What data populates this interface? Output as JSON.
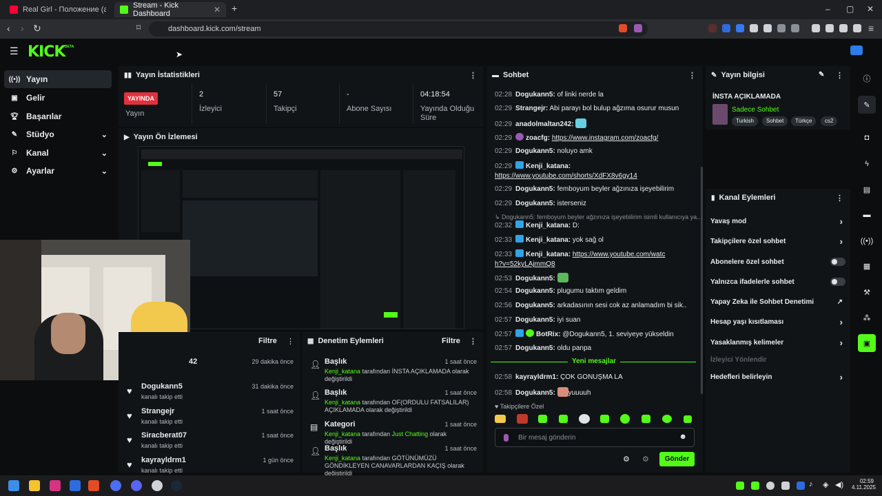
{
  "browser": {
    "tabs": [
      {
        "title": "Real Girl - Положение (alisherza"
      },
      {
        "title": "Stream - Kick Dashboard"
      }
    ],
    "url": "dashboard.kick.com/stream"
  },
  "brand": {
    "logo": "KICK",
    "beta": "BETA",
    "accent": "#53fc18"
  },
  "nav": {
    "items": [
      {
        "label": "Yayın",
        "icon": "broadcast-icon"
      },
      {
        "label": "Gelir",
        "icon": "revenue-icon"
      },
      {
        "label": "Başarılar",
        "icon": "trophy-icon"
      },
      {
        "label": "Stüdyo",
        "icon": "studio-icon"
      },
      {
        "label": "Kanal",
        "icon": "channel-icon"
      },
      {
        "label": "Ayarlar",
        "icon": "gear-icon"
      }
    ]
  },
  "stats": {
    "title": "Yayın İstatistikleri",
    "live_badge": "YAYINDA",
    "items": [
      {
        "label": "Yayın",
        "value": ""
      },
      {
        "label": "İzleyici",
        "value": "2"
      },
      {
        "label": "Takipçi",
        "value": "57"
      },
      {
        "label": "Abone Sayısı",
        "value": "-"
      },
      {
        "label": "Yayında Olduğu Süre",
        "value": "04:18:54"
      }
    ]
  },
  "preview": {
    "title": "Yayın Ön İzlemesi"
  },
  "followers": {
    "filter_label": "Filtre",
    "first_time": "29 dakika önce",
    "first_partial": "42",
    "items": [
      {
        "name": "Dogukann5",
        "sub": "kanalı takip etti",
        "time": "31 dakika önce"
      },
      {
        "name": "Strangejr",
        "sub": "kanalı takip etti",
        "time": "1 saat önce"
      },
      {
        "name": "Siracberat07",
        "sub": "kanalı takip etti",
        "time": "1 saat önce"
      },
      {
        "name": "kayrayldrm1",
        "sub": "kanalı takip etti",
        "time": "1 gün önce"
      }
    ]
  },
  "moderation": {
    "title": "Denetim Eylemleri",
    "filter_label": "Filtre",
    "items": [
      {
        "title": "Başlık",
        "user": "Kenji_katana",
        "pre": "tarafından ",
        "value": "İNSTA AÇIKLAMADA",
        "post": " olarak değiştirildi",
        "time": "1 saat önce"
      },
      {
        "title": "Başlık",
        "user": "Kenji_katana",
        "pre": "tarafından ",
        "value": "OF(ORDULU FATSALILAR) AÇIKLAMADA",
        "post": " olarak değiştirildi",
        "time": "1 saat önce"
      },
      {
        "title": "Kategori",
        "user": "Kenji_katana",
        "pre": "tarafından ",
        "value": "Just Chatting",
        "post": " olarak değiştirildi",
        "time": "1 saat önce"
      },
      {
        "title": "Başlık",
        "user": "Kenji_katana",
        "pre": "tarafından ",
        "value": "GÖTÜNÜMÜZÜ GÖNDİKLEYEN CANAVARLARDAN KAÇIŞ",
        "post": " olarak değiştirildi",
        "time": "1 saat önce"
      }
    ]
  },
  "chat": {
    "title": "Sohbet",
    "messages": [
      {
        "time": "02:28",
        "user": "Dogukann5:",
        "text": " of linki nerde la"
      },
      {
        "time": "02:29",
        "user": "Strangejr:",
        "text": " Abi parayı bol bulup ağzıma osurur musun"
      },
      {
        "time": "02:29",
        "user": "anadolmaltan242:",
        "text": ""
      },
      {
        "time": "02:29",
        "user": "zoacfg:",
        "text": "https://www.instagram.com/zoacfg/"
      },
      {
        "time": "02:29",
        "user": "Dogukann5:",
        "text": " noluyo amk"
      },
      {
        "time": "02:29",
        "user": "Kenji_katana:",
        "text": "https://www.youtube.com/shorts/XdFX8v6gy14"
      },
      {
        "time": "02:29",
        "user": "Dogukann5:",
        "text": " femboyum beyler ağzınıza işeyebilirim"
      },
      {
        "time": "02:29",
        "user": "Dogukann5:",
        "text": " isterseniz"
      },
      {
        "time": "",
        "user": "",
        "text": "Dogukann5: femboyum beyler ağzınıza işeyebilirim isimli kullanıcıya ya..."
      },
      {
        "time": "02:32",
        "user": "Kenji_katana:",
        "text": " D:"
      },
      {
        "time": "02:33",
        "user": "Kenji_katana:",
        "text": " yok sağ ol"
      },
      {
        "time": "02:33",
        "user": "Kenji_katana:",
        "text": "https://www.youtube.com/watch?v=52kyLAjmmQ8"
      },
      {
        "time": "02:53",
        "user": "Dogukann5:",
        "text": ""
      },
      {
        "time": "02:54",
        "user": "Dogukann5:",
        "text": " plugumu taktım geldim"
      },
      {
        "time": "02:56",
        "user": "Dogukann5:",
        "text": " arkadasının sesi cok az anlamadım bi sik.."
      },
      {
        "time": "02:57",
        "user": "Dogukann5:",
        "text": " iyi suan"
      },
      {
        "time": "02:57",
        "user": "BotRix:",
        "text": " @Dogukann5, 1. seviyeye yükseldin"
      },
      {
        "time": "02:57",
        "user": "Dogukann5:",
        "text": " oldu panpa"
      },
      {
        "time": "02:58",
        "user": "kayrayldrm1:",
        "text": " ÇOK GONUŞMA LA"
      },
      {
        "time": "02:58",
        "user": "Dogukann5:",
        "text": "yuuuuh"
      }
    ],
    "new_messages": "Yeni mesajlar",
    "followers_only": "Takipçilere Özel",
    "input_placeholder": "Bir mesaj gönderin",
    "send_label": "Gönder"
  },
  "info": {
    "title": "Yayın bilgisi",
    "stream_title": "İNSTA AÇIKLAMADA",
    "category": "Sadece Sohbet",
    "tags": [
      "Turkish",
      "Sohbet",
      "Türkçe",
      "cs2"
    ]
  },
  "actions": {
    "title": "Kanal Eylemleri",
    "items": [
      {
        "label": "Yavaş mod",
        "kind": "arrow"
      },
      {
        "label": "Takipçilere özel sohbet",
        "kind": "arrow"
      },
      {
        "label": "Abonelere özel sohbet",
        "kind": "toggle"
      },
      {
        "label": "Yalnızca ifadelerle sohbet",
        "kind": "toggle"
      },
      {
        "label": "Yapay Zeka ile Sohbet Denetimi",
        "kind": "external"
      },
      {
        "label": "Hesap yaşı kısıtlaması",
        "kind": "arrow"
      },
      {
        "label": "Yasaklanmış kelimeler",
        "kind": "arrow"
      },
      {
        "label": "İzleyici Yönlendir",
        "kind": "disabled"
      },
      {
        "label": "Hedefleri belirleyin",
        "kind": "arrow"
      }
    ]
  },
  "taskbar": {
    "time": "02:59",
    "date": "4.11.2025"
  }
}
